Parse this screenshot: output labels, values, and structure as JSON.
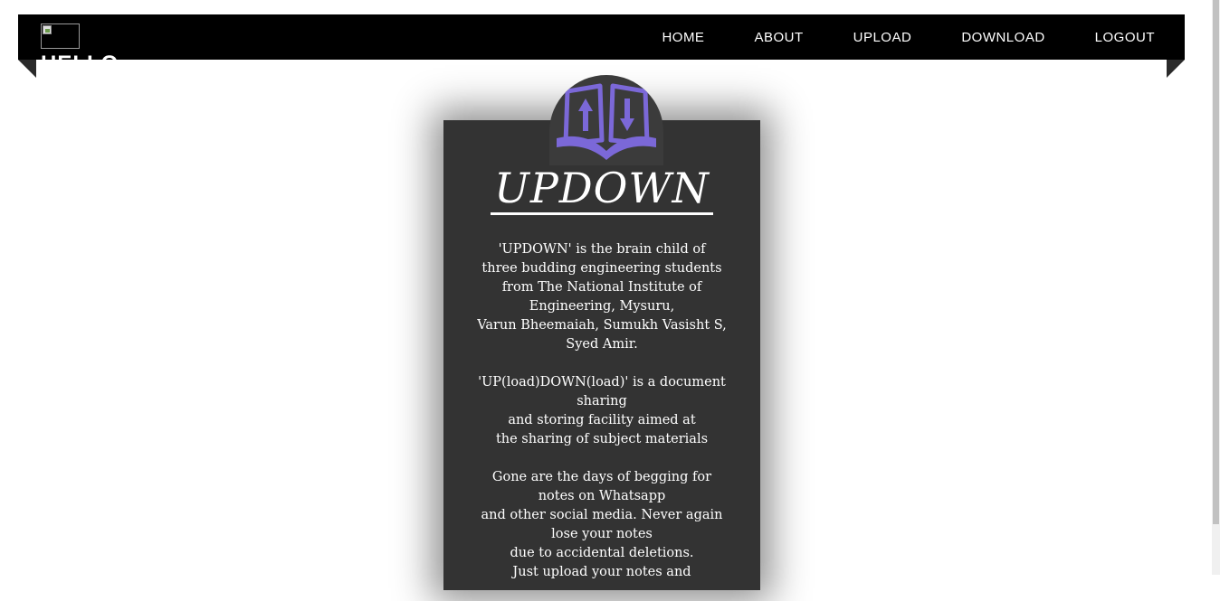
{
  "header": {
    "logo_alt": "",
    "greeting": "HELLO",
    "nav": [
      {
        "label": "HOME"
      },
      {
        "label": "ABOUT"
      },
      {
        "label": "UPLOAD"
      },
      {
        "label": "DOWNLOAD"
      },
      {
        "label": "LOGOUT"
      }
    ]
  },
  "card": {
    "emblem_icon": "book-updown-icon",
    "title": "UPDOWN",
    "paragraphs": [
      [
        "'UPDOWN' is the brain child of",
        "three budding engineering students",
        "from The National Institute of",
        "Engineering, Mysuru,",
        "Varun Bheemaiah, Sumukh Vasisht S,",
        "Syed Amir."
      ],
      [
        "'UP(load)DOWN(load)' is a document",
        "sharing",
        "and storing facility aimed at",
        "the sharing of subject materials"
      ],
      [
        "Gone are the days of begging for",
        "notes on Whatsapp",
        "and other social media. Never again",
        "lose your notes",
        "due to accidental deletions.",
        "Just upload your notes and"
      ]
    ]
  },
  "colors": {
    "navbar": "#000000",
    "card": "#333333",
    "emblem": "#7b68d8"
  }
}
